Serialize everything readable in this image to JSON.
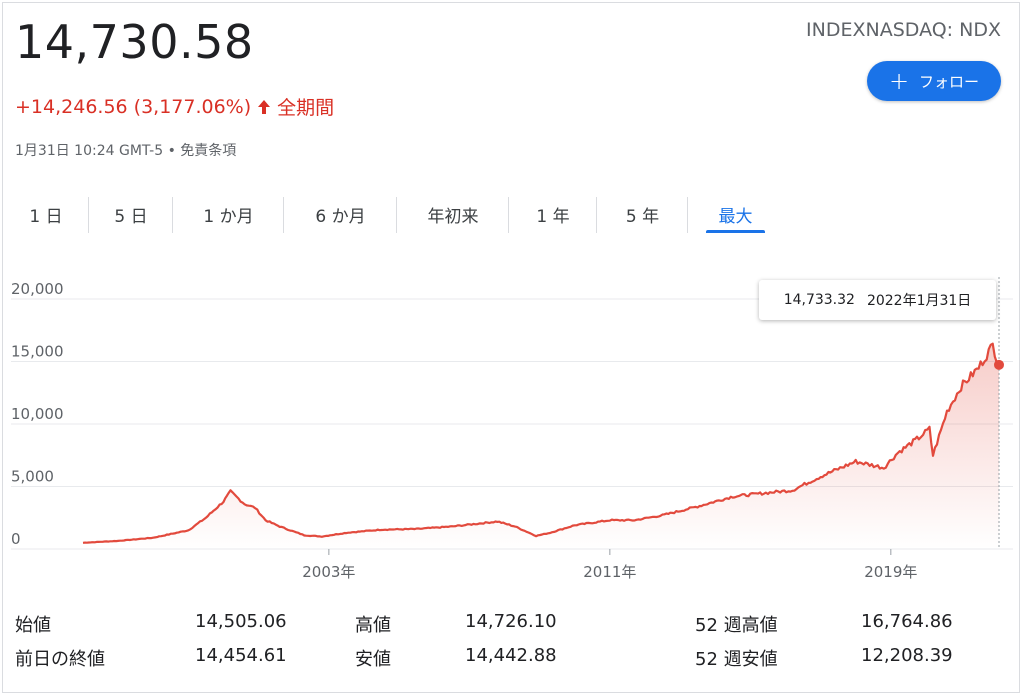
{
  "header": {
    "price": "14,730.58",
    "ticker": "INDEXNASDAQ: NDX",
    "follow_label": "フォロー",
    "change": "+14,246.56 (3,177.06%)",
    "change_period": "全期間",
    "timestamp": "1月31日 10:24 GMT-5 • 免責条項"
  },
  "tabs": [
    {
      "label": "1 日"
    },
    {
      "label": "5 日"
    },
    {
      "label": "1 か月"
    },
    {
      "label": "6 か月"
    },
    {
      "label": "年初来"
    },
    {
      "label": "1 年"
    },
    {
      "label": "5 年"
    },
    {
      "label": "最大",
      "active": true
    }
  ],
  "tooltip": {
    "value": "14,733.32",
    "date": "2022年1月31日"
  },
  "chart_data": {
    "type": "area",
    "line_color": "#e24a3d",
    "x_tick_labels": [
      "2003年",
      "2011年",
      "2019年"
    ],
    "y_tick_labels": [
      "0",
      "5,000",
      "10,000",
      "15,000",
      "20,000"
    ],
    "ylim": [
      0,
      20000
    ],
    "grid": true,
    "series": [
      {
        "x": [
          1996.0,
          1997.0,
          1998.0,
          1998.5,
          1999.0,
          1999.5,
          2000.0,
          2000.2,
          2000.6,
          2000.9,
          2001.2,
          2001.6,
          2001.9,
          2002.3,
          2002.8,
          2003.5,
          2004.5,
          2005.5,
          2006.5,
          2007.8,
          2008.3,
          2008.9,
          2009.3,
          2010.0,
          2011.0,
          2011.7,
          2012.5,
          2013.5,
          2014.5,
          2015.5,
          2016.2,
          2017.0,
          2018.0,
          2018.8,
          2019.2,
          2019.8,
          2020.1,
          2020.2,
          2020.6,
          2021.0,
          2021.5,
          2021.9,
          2022.08
        ],
        "values": [
          500,
          650,
          900,
          1200,
          1500,
          2500,
          3800,
          4600,
          3600,
          3300,
          2300,
          1800,
          1500,
          1100,
          1000,
          1300,
          1550,
          1600,
          1800,
          2200,
          1800,
          1050,
          1300,
          1900,
          2300,
          2300,
          2700,
          3400,
          4200,
          4500,
          4700,
          5800,
          7000,
          6500,
          7700,
          8900,
          9600,
          7500,
          11000,
          13000,
          14500,
          16300,
          14733
        ]
      }
    ],
    "last_point_value": 14733.32
  },
  "stats": {
    "open_label": "始値",
    "open_value": "14,505.06",
    "high_label": "高値",
    "high_value": "14,726.10",
    "week52_high_label": "52 週高値",
    "week52_high_value": "16,764.86",
    "prev_close_label": "前日の終値",
    "prev_close_value": "14,454.61",
    "low_label": "安値",
    "low_value": "14,442.88",
    "week52_low_label": "52 週安値",
    "week52_low_value": "12,208.39"
  }
}
